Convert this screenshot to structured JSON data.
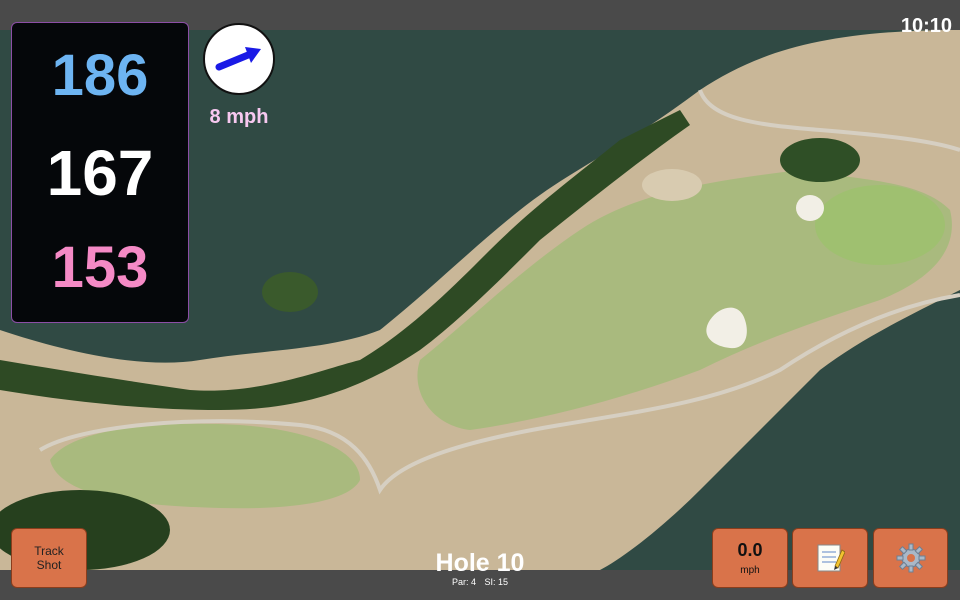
{
  "status_bar": {
    "time": "10:10"
  },
  "distances": {
    "back": "186",
    "middle": "167",
    "front": "153",
    "colors": {
      "back": "#6db4f2",
      "middle": "#ffffff",
      "front": "#f58ac6"
    }
  },
  "wind": {
    "speed": "8 mph",
    "icon": "wind-arrow-icon",
    "arrow_color": "#1a1ae6",
    "text_color": "#f7c8f0"
  },
  "hole": {
    "title": "Hole 10",
    "par": "Par: 4",
    "si": "SI: 15"
  },
  "buttons": {
    "track_shot": {
      "line1": "Track",
      "line2": "Shot"
    },
    "speed": {
      "value": "0.0",
      "unit": "mph"
    },
    "notes": {
      "icon": "notepad-icon"
    },
    "settings": {
      "icon": "gear-icon"
    },
    "color": "#d9734a"
  },
  "map": {
    "water": "#304a44",
    "fairway": "#a9ba7e",
    "rough": "#c9b798",
    "trees": "#2e4a24",
    "cart_path": "#d6cfc2",
    "bunker": "#f2efe6"
  }
}
